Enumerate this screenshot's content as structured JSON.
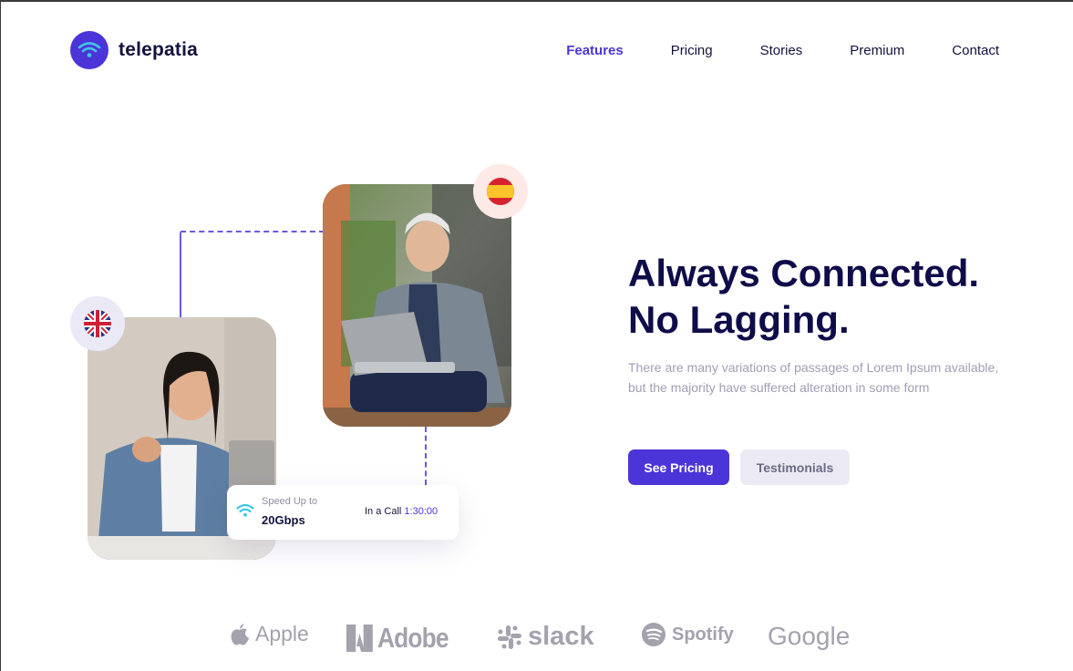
{
  "brand": {
    "name": "telepatia",
    "logo_icon": "wifi-icon",
    "accent": "#4c35d8"
  },
  "nav": {
    "items": [
      {
        "label": "Features",
        "active": true
      },
      {
        "label": "Pricing",
        "active": false
      },
      {
        "label": "Stories",
        "active": false
      },
      {
        "label": "Premium",
        "active": false
      },
      {
        "label": "Contact",
        "active": false
      }
    ]
  },
  "hero": {
    "headline_line1": "Always Connected.",
    "headline_line2": "No Lagging.",
    "description": "There are many variations of passages of Lorem Ipsum available, but the majority have suffered alteration in some form",
    "primary_button": "See Pricing",
    "secondary_button": "Testimonials"
  },
  "flags": {
    "top": "spain-flag-icon",
    "left": "uk-flag-icon"
  },
  "speed_card": {
    "label": "Speed Up to",
    "value": "20Gbps",
    "call_label": "In a Call",
    "call_time": "1:30:00",
    "icon": "wifi-icon"
  },
  "brands": [
    "Apple",
    "Adobe",
    "slack",
    "Spotify",
    "Google"
  ]
}
